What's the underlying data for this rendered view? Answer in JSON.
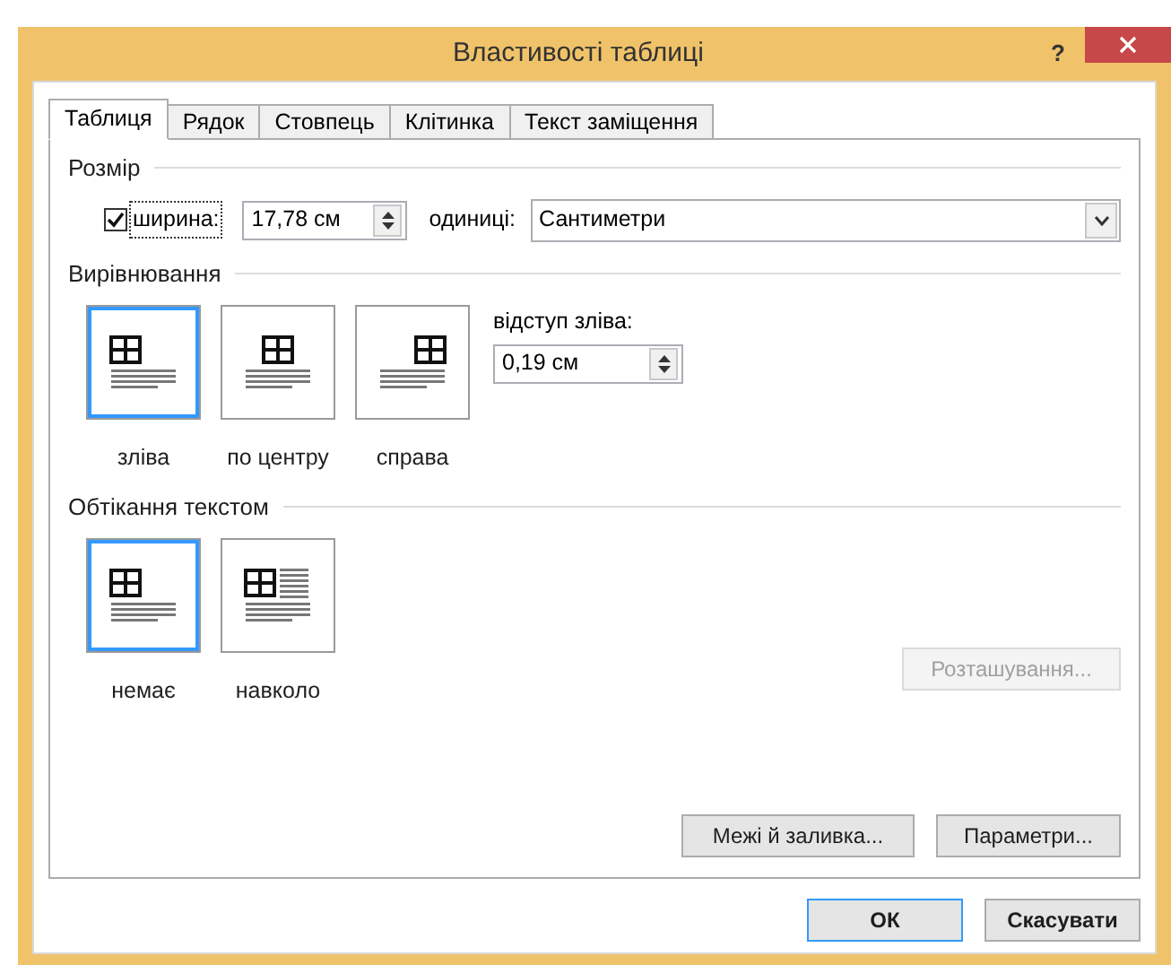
{
  "window": {
    "title": "Властивості таблиці",
    "help": "?"
  },
  "tabs": [
    {
      "label": "Таблиця",
      "selected": true
    },
    {
      "label": "Рядок",
      "selected": false
    },
    {
      "label": "Стовпець",
      "selected": false
    },
    {
      "label": "Клітинка",
      "selected": false
    },
    {
      "label": "Текст заміщення",
      "selected": false
    }
  ],
  "size": {
    "title": "Розмір",
    "width_checkbox": {
      "label": "ширина:",
      "checked": true
    },
    "width_value": "17,78 см",
    "units_label": "одиниці:",
    "units_value": "Сантиметри"
  },
  "alignment": {
    "title": "Вирівнювання",
    "options": [
      {
        "label": "зліва",
        "kind": "left",
        "selected": true
      },
      {
        "label": "по центру",
        "kind": "center",
        "selected": false
      },
      {
        "label": "справа",
        "kind": "right",
        "selected": false
      }
    ],
    "indent_label": "відступ зліва:",
    "indent_value": "0,19 см"
  },
  "wrapping": {
    "title": "Обтікання текстом",
    "options": [
      {
        "label": "немає",
        "kind": "none",
        "selected": true
      },
      {
        "label": "навколо",
        "kind": "around",
        "selected": false
      }
    ],
    "positioning_button": {
      "label": "Розташування...",
      "disabled": true
    }
  },
  "buttons": [
    {
      "label": "Межі й заливка..."
    },
    {
      "label": "Параметри..."
    }
  ],
  "footer_buttons": [
    {
      "label": "ОК",
      "default": true
    },
    {
      "label": "Скасувати",
      "default": false
    }
  ]
}
